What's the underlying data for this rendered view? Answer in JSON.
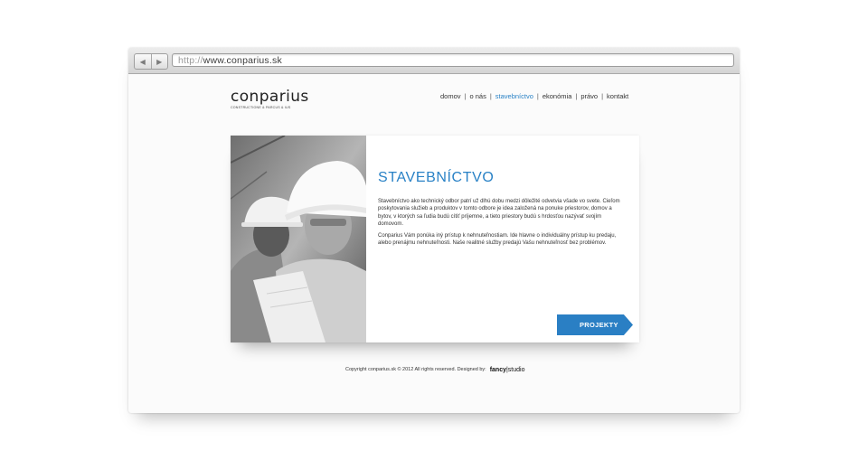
{
  "browser": {
    "url_scheme": "http://",
    "url_host": "www.conparius.sk",
    "back_glyph": "◀",
    "forward_glyph": "▶"
  },
  "logo": {
    "word": "conparius",
    "tagline": "CONSTRUCTIONE & PARCUS & IUS"
  },
  "nav": {
    "items": [
      {
        "label": "domov"
      },
      {
        "label": "o nás"
      },
      {
        "label": "stavebníctvo",
        "active": true
      },
      {
        "label": "ekonómia"
      },
      {
        "label": "právo"
      },
      {
        "label": "kontakt"
      }
    ],
    "separator": "|",
    "active_color": "#2a82c6"
  },
  "content": {
    "title": "STAVEBNÍCTVO",
    "paragraph1": "Stavebníctvo ako technický odbor patrí už dlhú dobu medzi dôležité odvetvia všade vo svete. Cieľom poskytovania služieb a produktov v tomto odbore je idea založená na ponuke priestorov, domov a bytov, v ktorých sa ľudia budú cítiť príjemne, a tieto priestory budú s hrdosťou nazývať svojím domovom.",
    "paragraph2": "Conparius Vám ponúka iný prístup k nehnuteľnostiam. Ide hlavne o individuálny prístup ku predaju, alebo prenájmu nehnuteľnosti. Naše realitné služby predajú Vašu nehnuteľnosť bez problémov.",
    "button_label": "PROJEKTY",
    "accent_color": "#2a7fc4"
  },
  "footer": {
    "text": "Copyright conparius.sk © 2012 All rights reserved. Designed by:",
    "studio_bold": "fancy",
    "studio_rest": "|studio"
  }
}
